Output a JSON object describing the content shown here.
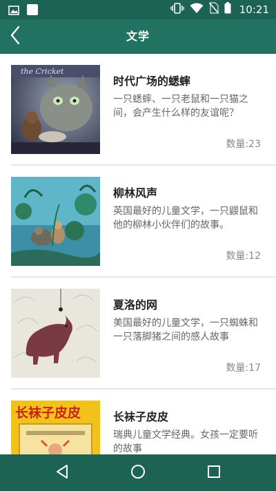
{
  "status_bar": {
    "time": "10:21",
    "icons": [
      "image-icon",
      "square-notification-icon",
      "vibrate-icon",
      "wifi-icon",
      "no-sim-icon",
      "battery-icon"
    ]
  },
  "app_bar": {
    "title": "文学",
    "back_icon": "back-chevron-icon"
  },
  "items": [
    {
      "title": "时代广场的蟋蟀",
      "description": "一只蟋蟀、一只老鼠和一只猫之间，会产生什么样的友谊呢？",
      "count": "数量:23"
    },
    {
      "title": "柳林风声",
      "description": "英国最好的儿童文学，一只鼹鼠和他的柳林小伙伴们的故事。",
      "count": "数量:12"
    },
    {
      "title": "夏洛的网",
      "description": "美国最好的儿童文学，一只蜘蛛和一只落脚猪之间的感人故事",
      "count": "数量:17"
    },
    {
      "title": "长袜子皮皮",
      "description": "瑞典儿童文学经典。女孩一定要听的故事",
      "count": "",
      "cover_text": "长袜子皮皮"
    }
  ],
  "nav_bar": {
    "buttons": [
      "back-triangle-icon",
      "home-circle-icon",
      "recents-square-icon"
    ]
  },
  "colors": {
    "status_bar": "#1d6354",
    "app_bar": "#227262",
    "nav_bar": "#1d6354"
  }
}
